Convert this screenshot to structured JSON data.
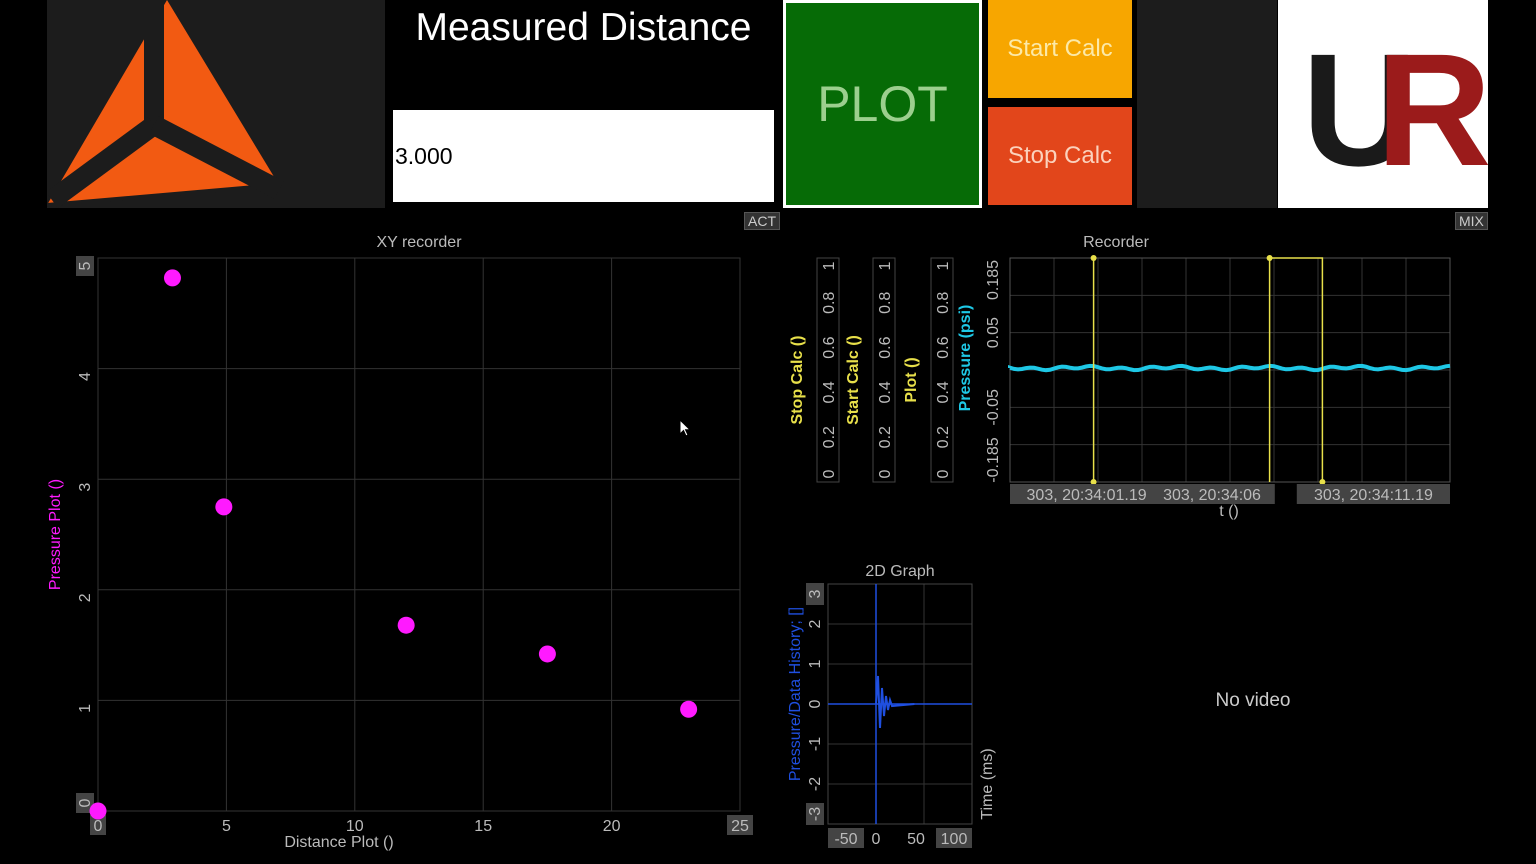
{
  "header": {
    "measured_distance_title": "Measured Distance",
    "measured_distance_value": "3.000",
    "plot_label": "PLOT",
    "start_calc_label": "Start Calc",
    "stop_calc_label": "Stop Calc",
    "act_tag": "ACT",
    "mix_tag": "MIX",
    "right_logo_text": "UR",
    "colors": {
      "plot": "#066b06",
      "start": "#f7a600",
      "stop": "#e2461b",
      "logo_left": "#f25a12",
      "logo_right": "#9b1b1b"
    }
  },
  "xy_recorder": {
    "title": "XY recorder",
    "chart_data": {
      "type": "scatter",
      "xlabel": "Distance Plot ()",
      "ylabel": "Pressure Plot ()",
      "xlim": [
        0,
        25
      ],
      "ylim": [
        0,
        5
      ],
      "x_ticks": [
        "0",
        "5",
        "10",
        "15",
        "20",
        "25"
      ],
      "y_ticks": [
        "0",
        "1",
        "2",
        "3",
        "4",
        "5"
      ],
      "grid": true,
      "color": "#ff1aff",
      "points": [
        {
          "x": 0,
          "y": 0
        },
        {
          "x": 2.9,
          "y": 4.82
        },
        {
          "x": 4.9,
          "y": 2.75
        },
        {
          "x": 12.0,
          "y": 1.68
        },
        {
          "x": 17.5,
          "y": 1.42
        },
        {
          "x": 23.0,
          "y": 0.92
        }
      ]
    }
  },
  "recorder": {
    "title": "Recorder",
    "chart_data": {
      "type": "line",
      "xlabel": "t ()",
      "x_ticks": [
        "303, 20:34:01.19",
        "303, 20:34:06",
        "303, 20:34:11.19"
      ],
      "axes": [
        {
          "label": "Stop Calc ()",
          "ticks": [
            "0",
            "0.2",
            "0.4",
            "0.6",
            "0.8",
            "1"
          ],
          "color": "#e8e04a"
        },
        {
          "label": "Start Calc ()",
          "ticks": [
            "0",
            "0.2",
            "0.4",
            "0.6",
            "0.8",
            "1"
          ],
          "color": "#e8e04a"
        },
        {
          "label": "Plot ()",
          "ticks": [
            "0",
            "0.2",
            "0.4",
            "0.6",
            "0.8",
            "1"
          ],
          "color": "#e8e04a"
        },
        {
          "label": "Pressure (psi)",
          "ticks": [
            "-0.185",
            "-0.05",
            "0.05",
            "0.185"
          ],
          "color": "#1ec8e6"
        }
      ],
      "ylim_pressure": [
        -0.185,
        0.185
      ],
      "pressure_level": 0.0,
      "plot_pulse": {
        "start_fraction": 0.19,
        "end_fraction": 0.19
      },
      "start_pulse": {
        "start_fraction": 0.59,
        "end_fraction": 0.71
      }
    }
  },
  "graph2d": {
    "title": "2D Graph",
    "chart_data": {
      "type": "line",
      "xlabel": "Time (ms)",
      "ylabel": "Pressure/Data History; []",
      "xlim": [
        -50,
        100
      ],
      "ylim": [
        -3,
        3
      ],
      "x_ticks": [
        "-50",
        "0",
        "50",
        "100"
      ],
      "y_ticks": [
        "-3",
        "-2",
        "-1",
        "0",
        "1",
        "2",
        "3"
      ],
      "color": "#1f4fe0"
    }
  },
  "video": {
    "no_video_text": "No video"
  }
}
